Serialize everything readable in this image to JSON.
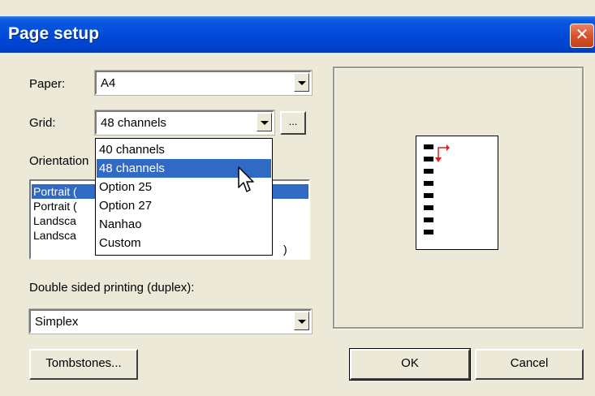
{
  "window": {
    "title": "Page setup",
    "close_glyph": "✕"
  },
  "form": {
    "paper_label": "Paper:",
    "paper_value": "A4",
    "grid_label": "Grid:",
    "grid_value": "48 channels",
    "grid_more_label": "...",
    "orientation_label": "Orientation",
    "orientation_items": [
      "Portrait (",
      "Portrait (",
      "Landsca",
      "Landsca"
    ],
    "orientation_last_suffix": ")",
    "duplex_label": "Double sided printing (duplex):",
    "duplex_value": "Simplex"
  },
  "grid_dropdown": {
    "options": [
      "40 channels",
      "48 channels",
      "Option 25",
      "Option 27",
      "Nanhao",
      "Custom"
    ],
    "highlighted_index": 1
  },
  "buttons": {
    "tombstones": "Tombstones...",
    "ok": "OK",
    "cancel": "Cancel"
  },
  "colors": {
    "selection": "#316ac5",
    "marker_red": "#e0201a"
  },
  "icons": [
    "close-icon",
    "dropdown-arrow-icon",
    "mouse-pointer-icon",
    "orientation-marker-icon"
  ]
}
